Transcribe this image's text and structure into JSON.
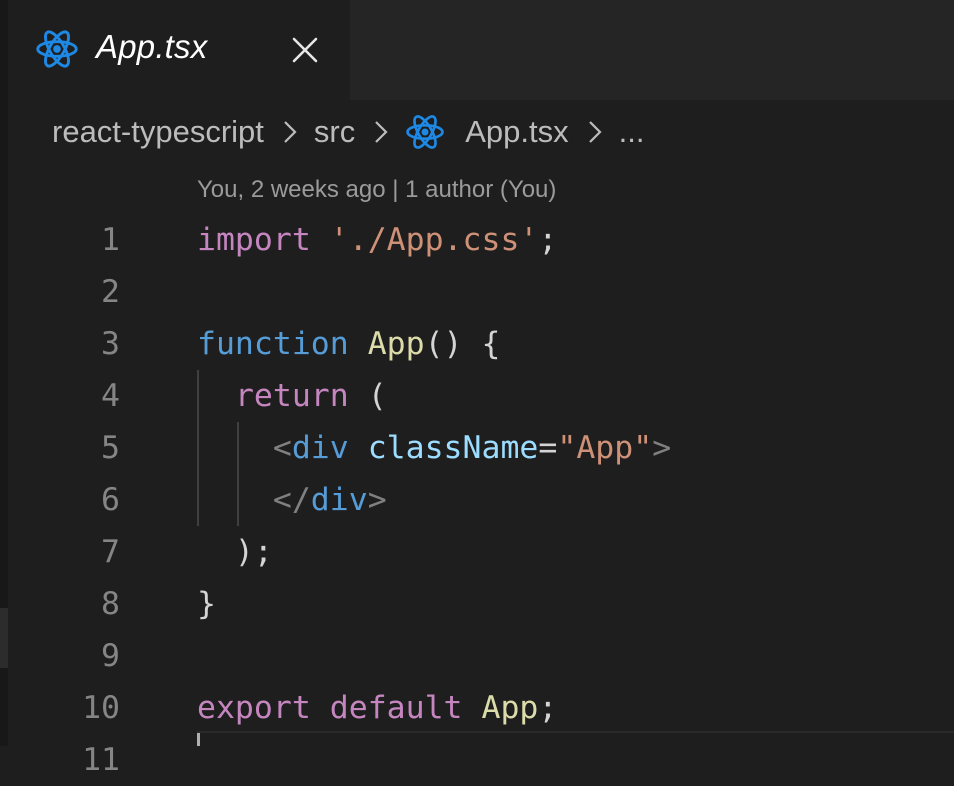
{
  "tab": {
    "icon": "react-icon",
    "label": "App.tsx",
    "close_icon": "close-icon"
  },
  "breadcrumb": {
    "items": [
      "react-typescript",
      "src",
      "App.tsx",
      "..."
    ],
    "separator_icon": "chevron-right-icon"
  },
  "blame": {
    "text": "You, 2 weeks ago | 1 author (You)"
  },
  "editor": {
    "lines": [
      {
        "number": "1",
        "tokens": [
          {
            "t": "import",
            "c": "kw"
          },
          {
            "t": " ",
            "c": "punc"
          },
          {
            "t": "'./App.css'",
            "c": "str"
          },
          {
            "t": ";",
            "c": "punc"
          }
        ]
      },
      {
        "number": "2",
        "tokens": []
      },
      {
        "number": "3",
        "tokens": [
          {
            "t": "function",
            "c": "fn"
          },
          {
            "t": " ",
            "c": "punc"
          },
          {
            "t": "App",
            "c": "name"
          },
          {
            "t": "() {",
            "c": "punc"
          }
        ]
      },
      {
        "number": "4",
        "tokens": [
          {
            "t": "  ",
            "c": "punc"
          },
          {
            "t": "return",
            "c": "kw"
          },
          {
            "t": " (",
            "c": "punc"
          }
        ]
      },
      {
        "number": "5",
        "tokens": [
          {
            "t": "    ",
            "c": "punc"
          },
          {
            "t": "<",
            "c": "br"
          },
          {
            "t": "div",
            "c": "tag"
          },
          {
            "t": " ",
            "c": "punc"
          },
          {
            "t": "className",
            "c": "attr"
          },
          {
            "t": "=",
            "c": "punc"
          },
          {
            "t": "\"App\"",
            "c": "str"
          },
          {
            "t": ">",
            "c": "br"
          }
        ]
      },
      {
        "number": "6",
        "tokens": [
          {
            "t": "    ",
            "c": "punc"
          },
          {
            "t": "</",
            "c": "br"
          },
          {
            "t": "div",
            "c": "tag"
          },
          {
            "t": ">",
            "c": "br"
          }
        ]
      },
      {
        "number": "7",
        "tokens": [
          {
            "t": "  );",
            "c": "punc"
          }
        ]
      },
      {
        "number": "8",
        "tokens": [
          {
            "t": "}",
            "c": "punc"
          }
        ]
      },
      {
        "number": "9",
        "tokens": []
      },
      {
        "number": "10",
        "tokens": [
          {
            "t": "export",
            "c": "kw"
          },
          {
            "t": " ",
            "c": "punc"
          },
          {
            "t": "default",
            "c": "kw"
          },
          {
            "t": " ",
            "c": "punc"
          },
          {
            "t": "App",
            "c": "name"
          },
          {
            "t": ";",
            "c": "punc"
          }
        ]
      },
      {
        "number": "11",
        "tokens": []
      }
    ]
  },
  "colors": {
    "background": "#1e1e1e",
    "keyword": "#c586c0",
    "function_keyword": "#569cd6",
    "string": "#ce9178",
    "identifier": "#dcdcaa",
    "attribute": "#9cdcfe",
    "react_icon": "#1e88e5"
  }
}
